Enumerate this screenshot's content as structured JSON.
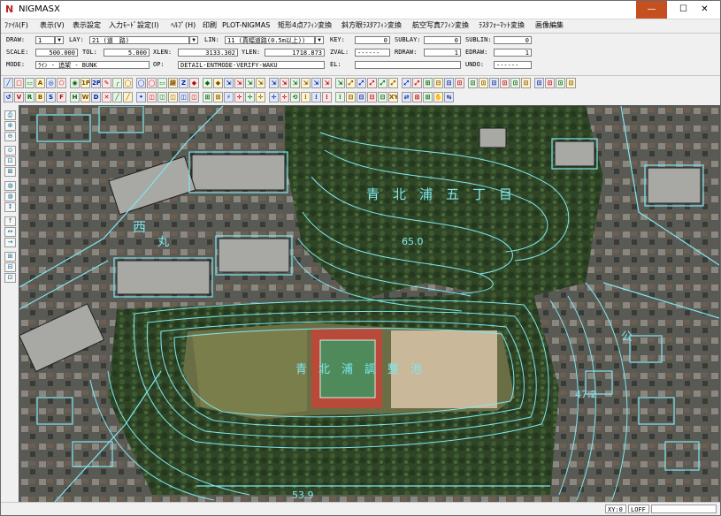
{
  "window": {
    "title": "NIGMASX",
    "icon": "N",
    "buttons": {
      "minimize": "—",
      "maximize": "☐",
      "close": "✕"
    }
  },
  "menu": [
    "ﾌｧｲﾙ(F)",
    "表示(V)",
    "表示設定",
    "入力ﾓｰﾄﾞ設定(I)",
    "ﾍﾙﾌﾟ(H)",
    "印刷",
    "PLOT-NIGMAS",
    "矩形4点ｱﾌｨﾝ変換",
    "斜方眼ﾗｽﾀｱﾌｨﾝ変換",
    "航空写真ｱﾌｨﾝ変換",
    "ﾗｽﾀﾌｫｰﾏｯﾄ変換",
    "画像編集"
  ],
  "status": {
    "draw_label": "DRAW:",
    "draw_value": "1",
    "lay_label": "LAY:",
    "lay_value": "21 (道　路)",
    "lin_label": "LIN:",
    "lin_value": "11 (真幅道路(0.5m以上))",
    "key_label": "KEY:",
    "key_value": "0",
    "sublay_label": "SUBLAY:",
    "sublay_value": "0",
    "sublin_label": "SUBLIN:",
    "sublin_value": "0",
    "scale_label": "SCALE:",
    "scale_value": "500.000",
    "tol_label": "TOL:",
    "tol_value": "5.000",
    "xlen_label": "XLEN:",
    "xlen_value": "3133.302",
    "ylen_label": "YLEN:",
    "ylen_value": "1718.873",
    "zval_label": "ZVAL:",
    "zval_value": "------",
    "rdraw_label": "RDRAW:",
    "rdraw_value": "1",
    "edraw_label": "EDRAW:",
    "edraw_value": "1",
    "mode_label": "MODE:",
    "mode_value": "ﾗｲﾝ - 追架 - BUNK",
    "op_label": "OP:",
    "op_value": "DETAIL-ENTMODE-VERIFY-WAKU",
    "el_label": "EL:",
    "el_value": "",
    "undo_label": "UNDO:",
    "undo_value": "------"
  },
  "toolbar_row1": [
    "╱",
    "□",
    "▭",
    "A",
    "◎",
    "⬠",
    "◉",
    "1P",
    "2P",
    "✎",
    "╭",
    "◯",
    "◯",
    "◯",
    "▭",
    "線",
    "Z",
    "◆",
    "◆",
    "◆",
    "⇲",
    "⇲",
    "⇲",
    "⇲",
    "⇲",
    "⇲",
    "⇲",
    "⇲",
    "⇲",
    "⇲",
    "⇲",
    "⤢",
    "⤢",
    "⤢",
    "⤢",
    "⤢",
    "⤢",
    "⤢",
    "⊞",
    "⊟",
    "⊡",
    "⊡",
    "⊡",
    "⊡",
    "⊡",
    "⊡",
    "⊡",
    "⊡",
    "⊡",
    "⊡",
    "⊡",
    "⊡"
  ],
  "toolbar_row2": [
    "↺",
    "V",
    "R",
    "B",
    "S",
    "F",
    "H",
    "W",
    "D",
    "✕",
    "╱",
    "╱",
    "•",
    "◫",
    "◫",
    "◫",
    "◫",
    "◫",
    "⊞",
    "⊞",
    "⚡",
    "✛",
    "✛",
    "✛",
    "✛",
    "✛",
    "⟲",
    "⁞",
    "⁞",
    "⁞",
    "⁞",
    "⊟",
    "⊟",
    "⊟",
    "⊟",
    "XY",
    "⇄",
    "⊞",
    "⊞",
    "✋",
    "⇆"
  ],
  "left_tools": [
    "⎙",
    "⊕",
    "⊖",
    "⊙",
    "⊡",
    "⊠",
    "◍",
    "◍",
    "↕",
    "↑",
    "↔",
    "→",
    "⊞",
    "⊟",
    "⊡"
  ],
  "map_labels": [
    "青　北　浦　五　丁　目",
    "青　北　浦　調　整　池",
    "65.0",
    "47.2",
    "53.9",
    "西",
    "丸",
    "公"
  ],
  "statusbar": {
    "xy": "XY:0",
    "loff": "LOFF",
    "blank": ""
  },
  "colors": {
    "accent": "#c3501e",
    "map_line": "#7fe8f0"
  }
}
